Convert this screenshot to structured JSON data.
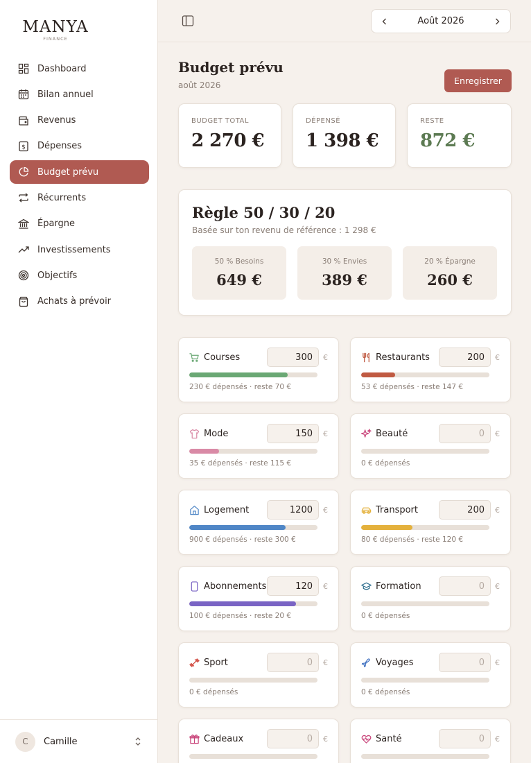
{
  "brand": {
    "name": "MANYA",
    "tagline": "FINANCE"
  },
  "nav": {
    "items": [
      {
        "label": "Dashboard",
        "icon": "dashboard-icon",
        "active": false
      },
      {
        "label": "Bilan annuel",
        "icon": "calendar-icon",
        "active": false
      },
      {
        "label": "Revenus",
        "icon": "wallet-icon",
        "active": false
      },
      {
        "label": "Dépenses",
        "icon": "receipt-icon",
        "active": false
      },
      {
        "label": "Budget prévu",
        "icon": "pie-chart-icon",
        "active": true
      },
      {
        "label": "Récurrents",
        "icon": "repeat-icon",
        "active": false
      },
      {
        "label": "Épargne",
        "icon": "bank-icon",
        "active": false
      },
      {
        "label": "Investissements",
        "icon": "trend-up-icon",
        "active": false
      },
      {
        "label": "Objectifs",
        "icon": "target-icon",
        "active": false
      },
      {
        "label": "Achats à prévoir",
        "icon": "shopping-bag-icon",
        "active": false
      }
    ]
  },
  "user": {
    "initial": "C",
    "name": "Camille"
  },
  "topbar": {
    "month": "Août 2026"
  },
  "header": {
    "title": "Budget prévu",
    "subtitle": "août 2026",
    "save_label": "Enregistrer"
  },
  "summary": {
    "total": {
      "label": "BUDGET TOTAL",
      "value": "2 270 €"
    },
    "spent": {
      "label": "DÉPENSÉ",
      "value": "1 398 €"
    },
    "remaining": {
      "label": "RESTE",
      "value": "872 €"
    }
  },
  "rule": {
    "title": "Règle 50 / 30 / 20",
    "subtitle": "Basée sur ton revenu de référence : 1 298 €",
    "needs": {
      "label": "50 % Besoins",
      "value": "649 €"
    },
    "wants": {
      "label": "30 % Envies",
      "value": "389 €"
    },
    "savings": {
      "label": "20 % Épargne",
      "value": "260 €"
    }
  },
  "colors": {
    "accent": "#b05a52",
    "green": "#5c7a52"
  },
  "currency": "€",
  "categories": [
    {
      "name": "Courses",
      "icon": "cart-icon",
      "budget": "300",
      "footer": "230 € dépensés · reste 70 €",
      "progress": 0.767,
      "color": "#6aa874"
    },
    {
      "name": "Restaurants",
      "icon": "fork-knife-icon",
      "budget": "200",
      "footer": "53 € dépensés · reste 147 €",
      "progress": 0.265,
      "color": "#c05a42"
    },
    {
      "name": "Mode",
      "icon": "shirt-icon",
      "budget": "150",
      "footer": "35 € dépensés · reste 115 €",
      "progress": 0.233,
      "color": "#d98aa6"
    },
    {
      "name": "Beauté",
      "icon": "sparkles-icon",
      "budget": "0",
      "footer": "0 € dépensés",
      "progress": 0,
      "color": "#c9447a"
    },
    {
      "name": "Logement",
      "icon": "home-icon",
      "budget": "1200",
      "footer": "900 € dépensés · reste 300 €",
      "progress": 0.75,
      "color": "#4f86c6"
    },
    {
      "name": "Transport",
      "icon": "car-icon",
      "budget": "200",
      "footer": "80 € dépensés · reste 120 €",
      "progress": 0.4,
      "color": "#e4b13c"
    },
    {
      "name": "Abonnements",
      "icon": "phone-icon",
      "budget": "120",
      "footer": "100 € dépensés · reste 20 €",
      "progress": 0.833,
      "color": "#7a64c4"
    },
    {
      "name": "Formation",
      "icon": "graduation-cap-icon",
      "budget": "0",
      "footer": "0 € dépensés",
      "progress": 0,
      "color": "#2f6f8f"
    },
    {
      "name": "Sport",
      "icon": "dumbbell-icon",
      "budget": "0",
      "footer": "0 € dépensés",
      "progress": 0,
      "color": "#d0453a"
    },
    {
      "name": "Voyages",
      "icon": "plane-icon",
      "budget": "0",
      "footer": "0 € dépensés",
      "progress": 0,
      "color": "#3d6fc0"
    },
    {
      "name": "Cadeaux",
      "icon": "gift-icon",
      "budget": "0",
      "footer": "",
      "progress": 0,
      "color": "#c9447a"
    },
    {
      "name": "Santé",
      "icon": "heart-pulse-icon",
      "budget": "0",
      "footer": "",
      "progress": 0,
      "color": "#c9447a"
    }
  ]
}
